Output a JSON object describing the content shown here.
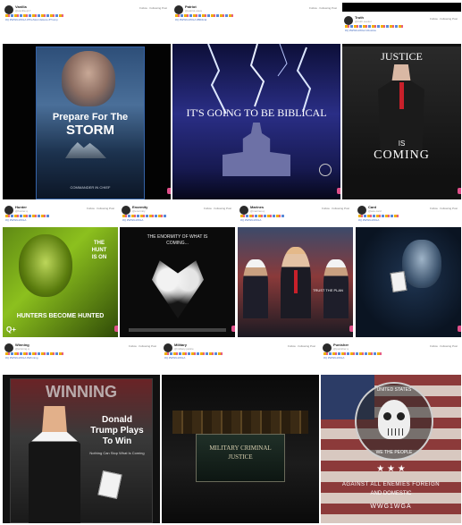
{
  "posts": [
    {
      "name": "Vanilla",
      "handle": "@vanilla.q17",
      "follow": "Follow · Following Post",
      "hashtags": "#Q #WWG1WGA #TheStormIsHere #Trump",
      "caption_main": "Prepare For The",
      "caption_big": "STORM",
      "caption_small": "COMMANDER IN CHIEF"
    },
    {
      "name": "Patriot",
      "handle": "@patriot.wave",
      "follow": "Follow · Following Post",
      "hashtags": "#Q #WWG1WGA #Biblical",
      "caption_main": "IT'S GOING TO BE BIBLICAL"
    },
    {
      "name": "Truth",
      "handle": "@truth.seeker",
      "follow": "Follow · Following Post",
      "hashtags": "#Q #WWG1WGA #Justice",
      "caption_top": "JUSTICE",
      "caption_mid": "IS",
      "caption_bottom": "COMING"
    },
    {
      "name": "Hunter",
      "handle": "@hunter.q",
      "follow": "Follow · Following Post",
      "hashtags": "#Q #WWG1WGA",
      "caption_main": "THE HUNT IS ON",
      "caption_bottom": "HUNTERS BECOME HUNTED",
      "caption_corner": "Q+"
    },
    {
      "name": "Enormity",
      "handle": "@enormity",
      "follow": "Follow · Following Post",
      "hashtags": "#Q #WWG1WGA",
      "caption_main": "THE ENORMITY OF WHAT IS COMING..."
    },
    {
      "name": "Marines",
      "handle": "@marines.q",
      "follow": "Follow · Following Post",
      "hashtags": "#Q #WWG1WGA",
      "caption_main": "TRUST THE PLAN"
    },
    {
      "name": "Card",
      "handle": "@ace.card",
      "follow": "Follow · Following Post",
      "hashtags": "#Q #WWG1WGA",
      "caption_main": ""
    },
    {
      "name": "Winning",
      "handle": "@winning.q",
      "follow": "Follow · Following Post",
      "hashtags": "#Q #WWG1WGA #Winning",
      "caption_top": "WINNING",
      "caption_main": "Donald Trump Plays To Win",
      "caption_small": "Nothing Can Stop What Is Coming"
    },
    {
      "name": "Military",
      "handle": "@military.justice",
      "follow": "Follow · Following Post",
      "hashtags": "#Q #WWG1WGA",
      "caption_main": "MILITARY CRIMINAL JUSTICE"
    },
    {
      "name": "Punisher",
      "handle": "@punisher.q",
      "follow": "Follow · Following Post",
      "hashtags": "#Q #WWG1WGA",
      "caption_ring": "UNITED STATES",
      "caption_ring2": "WE THE PEOPLE",
      "caption_main": "AGAINST ALL ENEMIES FOREIGN",
      "caption_sub": "AND DOMESTIC",
      "caption_bottom": "WWG1WGA"
    }
  ]
}
